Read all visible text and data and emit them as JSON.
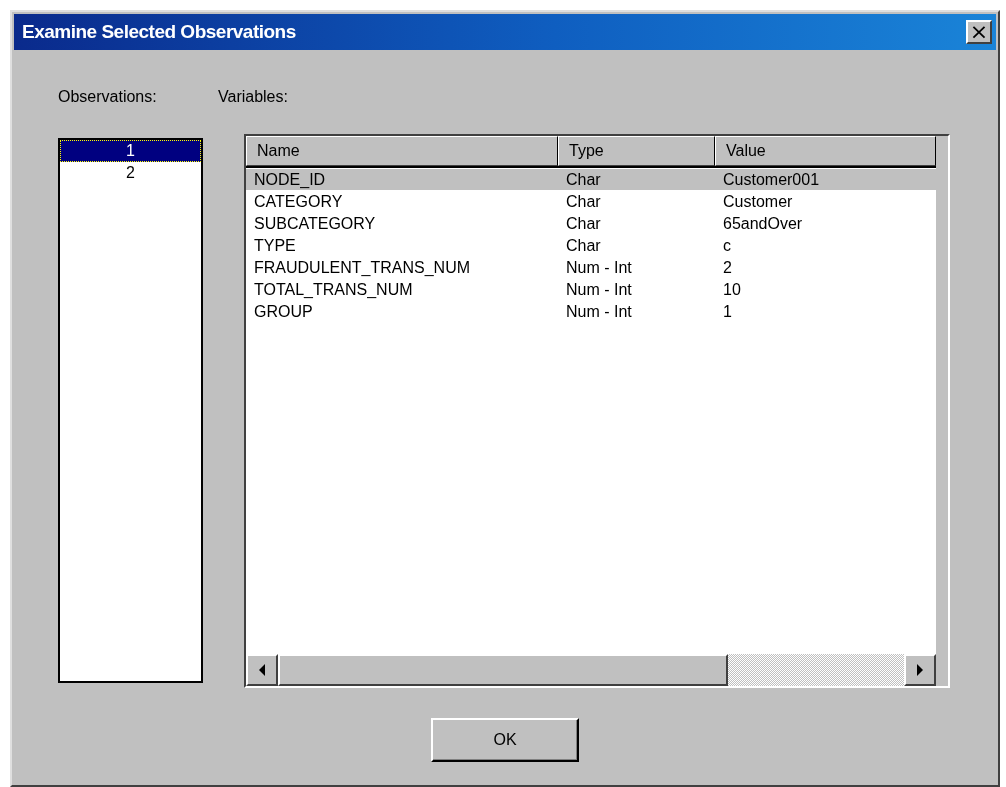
{
  "window": {
    "title": "Examine Selected Observations",
    "close": "×"
  },
  "observations": {
    "label": "Observations:",
    "items": [
      {
        "label": "1",
        "selected": true
      },
      {
        "label": "2",
        "selected": false
      }
    ]
  },
  "variables": {
    "label": "Variables:",
    "columns": [
      "Name",
      "Type",
      "Value"
    ],
    "rows": [
      {
        "name": "NODE_ID",
        "type": "Char",
        "value": "Customer001",
        "selected": true
      },
      {
        "name": "CATEGORY",
        "type": "Char",
        "value": "Customer",
        "selected": false
      },
      {
        "name": "SUBCATEGORY",
        "type": "Char",
        "value": "65andOver",
        "selected": false
      },
      {
        "name": "TYPE",
        "type": "Char",
        "value": "c",
        "selected": false
      },
      {
        "name": "FRAUDULENT_TRANS_NUM",
        "type": "Num - Int",
        "value": "2",
        "selected": false
      },
      {
        "name": "TOTAL_TRANS_NUM",
        "type": "Num - Int",
        "value": "10",
        "selected": false
      },
      {
        "name": "GROUP",
        "type": "Num - Int",
        "value": "1",
        "selected": false
      }
    ]
  },
  "buttons": [
    "OK"
  ]
}
